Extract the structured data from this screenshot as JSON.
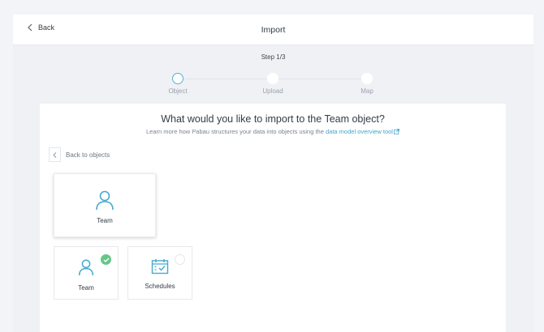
{
  "header": {
    "back_label": "Back",
    "title": "Import"
  },
  "stepper": {
    "step_label": "Step 1/3",
    "steps": [
      {
        "label": "Object",
        "state": "active"
      },
      {
        "label": "Upload",
        "state": "pending"
      },
      {
        "label": "Map",
        "state": "pending"
      }
    ]
  },
  "main": {
    "heading": "What would you like to import to the Team object?",
    "subtext": "Learn more how Pabau structures your data into objects using the",
    "link_text": "data model overview tool",
    "back_to_objects": "Back to objects",
    "selected_object": {
      "name": "Team",
      "icon": "person-icon"
    },
    "options": [
      {
        "name": "Team",
        "icon": "person-icon",
        "selected": true
      },
      {
        "name": "Schedules",
        "icon": "calendar-check-icon",
        "selected": false
      }
    ]
  },
  "colors": {
    "accent": "#54b2d3",
    "link": "#3fa4cc",
    "check": "#65c786",
    "background": "#eff1f4"
  }
}
